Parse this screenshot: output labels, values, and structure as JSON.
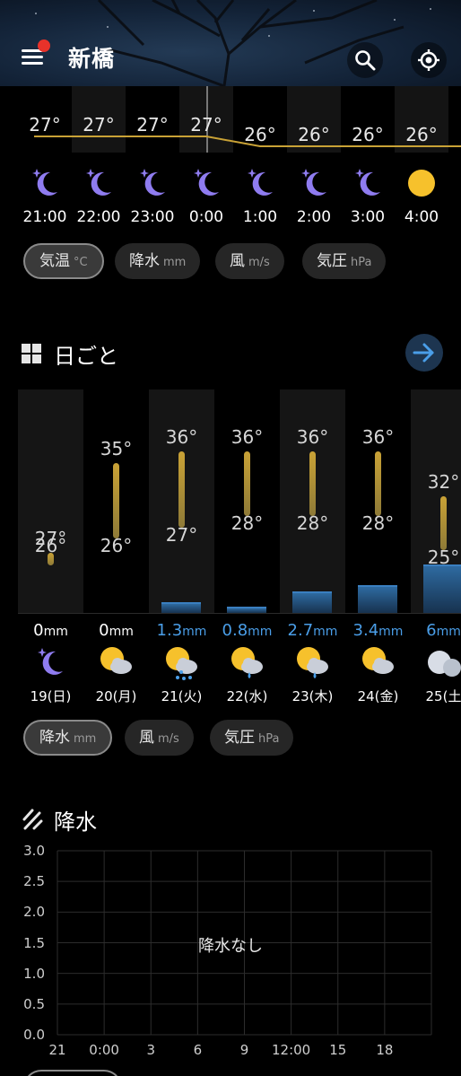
{
  "header": {
    "city": "新橋",
    "icons": [
      "menu-icon",
      "search-icon",
      "locate-icon"
    ]
  },
  "hourly": {
    "temps": [
      "27°",
      "27°",
      "27°",
      "27°",
      "26°",
      "26°",
      "26°",
      "26°"
    ],
    "times": [
      "21:00",
      "22:00",
      "23:00",
      "0:00",
      "1:00",
      "2:00",
      "3:00",
      "4:00"
    ],
    "icons": [
      "moon-stars-icon",
      "moon-stars-icon",
      "moon-stars-icon",
      "moon-stars-icon",
      "moon-stars-icon",
      "moon-stars-icon",
      "moon-stars-icon",
      "sun-icon"
    ],
    "current_hour_index": 3,
    "tabs": [
      {
        "label": "気温",
        "unit": "°C",
        "selected": true
      },
      {
        "label": "降水",
        "unit": "mm",
        "selected": false
      },
      {
        "label": "風",
        "unit": "m/s",
        "selected": false
      },
      {
        "label": "気圧",
        "unit": "hPa",
        "selected": false
      }
    ]
  },
  "daily": {
    "title": "日ごと",
    "days": [
      {
        "date": "19(日)",
        "high": "27°",
        "low": "26°",
        "high_val": 27,
        "low_val": 26,
        "precip": "0",
        "precip_val": 0,
        "unit": "mm",
        "icon": "moon-stars-icon"
      },
      {
        "date": "20(月)",
        "high": "35°",
        "low": "26°",
        "high_val": 35,
        "low_val": 26,
        "precip": "0",
        "precip_val": 0,
        "unit": "mm",
        "icon": "sun-cloud-icon"
      },
      {
        "date": "21(火)",
        "high": "36°",
        "low": "27°",
        "high_val": 36,
        "low_val": 27,
        "precip": "1.3",
        "precip_val": 1.3,
        "unit": "mm",
        "icon": "sun-cloud-rain-icon"
      },
      {
        "date": "22(水)",
        "high": "36°",
        "low": "28°",
        "high_val": 36,
        "low_val": 28,
        "precip": "0.8",
        "precip_val": 0.8,
        "unit": "mm",
        "icon": "sun-cloud-drop-icon"
      },
      {
        "date": "23(木)",
        "high": "36°",
        "low": "28°",
        "high_val": 36,
        "low_val": 28,
        "precip": "2.7",
        "precip_val": 2.7,
        "unit": "mm",
        "icon": "sun-cloud-drop-icon"
      },
      {
        "date": "24(金)",
        "high": "36°",
        "low": "28°",
        "high_val": 36,
        "low_val": 28,
        "precip": "3.4",
        "precip_val": 3.4,
        "unit": "mm",
        "icon": "sun-cloud-icon"
      },
      {
        "date": "25(土",
        "high": "32°",
        "low": "25°",
        "high_val": 32,
        "low_val": 25,
        "precip": "6",
        "precip_val": 6,
        "unit": "mm",
        "icon": "cloud-icon"
      }
    ],
    "tabs": [
      {
        "label": "降水",
        "unit": "mm",
        "selected": true
      },
      {
        "label": "風",
        "unit": "m/s",
        "selected": false
      },
      {
        "label": "気圧",
        "unit": "hPa",
        "selected": false
      }
    ]
  },
  "rain": {
    "title": "降水",
    "empty_message": "降水なし"
  },
  "chart_data": {
    "type": "bar",
    "title": "",
    "x": [
      "21",
      "0:00",
      "3",
      "6",
      "9",
      "12:00",
      "15",
      "18"
    ],
    "values": [],
    "ylim": [
      0,
      3.0
    ],
    "yticks": [
      "3.0",
      "2.5",
      "2.0",
      "1.5",
      "1.0",
      "0.5",
      "0.0"
    ],
    "grid": true
  },
  "colors": {
    "accent_blue": "#4a9ee8",
    "moon": "#8f7cf0",
    "sun": "#f6c12c",
    "temp_line": "#c9a236"
  }
}
